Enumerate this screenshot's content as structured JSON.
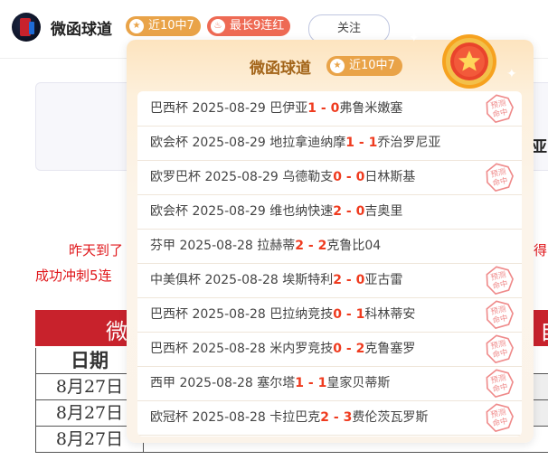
{
  "header": {
    "author": "微函球道",
    "badge_win": "近10中7",
    "badge_streak": "最长9连红",
    "follow_label": "关注"
  },
  "article": {
    "infobox_partial": "亚",
    "line1": "昨天到了",
    "line1_right": "得",
    "line2": "成功冲刺5连",
    "table": {
      "title_left": "微",
      "title_right": "自",
      "col_date": "日期",
      "dates": [
        "8月27日",
        "8月27日",
        "8月27日"
      ]
    }
  },
  "popup": {
    "title": "微函球道",
    "badge": "近10中7",
    "stamp_text": [
      "预测",
      "命中"
    ],
    "matches": [
      {
        "league": "巴西杯",
        "date": "2025-08-29",
        "home": "巴伊亚",
        "hs": "1",
        "sep": " - ",
        "as": "0",
        "away": "弗鲁米嫩塞",
        "hit": true
      },
      {
        "league": "欧会杯",
        "date": "2025-08-29",
        "home": "地拉拿迪纳摩",
        "hs": "1",
        "sep": " - ",
        "as": "1",
        "away": "乔治罗尼亚",
        "hit": false
      },
      {
        "league": "欧罗巴杯",
        "date": "2025-08-29",
        "home": "乌德勒支",
        "hs": "0",
        "sep": " - ",
        "as": "0",
        "away": "日林斯基",
        "hit": true
      },
      {
        "league": "欧会杯",
        "date": "2025-08-29",
        "home": "维也纳快速",
        "hs": "2",
        "sep": " - ",
        "as": "0",
        "away": "吉奥里",
        "hit": false
      },
      {
        "league": "芬甲",
        "date": "2025-08-28",
        "home": "拉赫蒂",
        "hs": "2",
        "sep": " - ",
        "as": "2",
        "away": "克鲁比04",
        "hit": false
      },
      {
        "league": "中美俱杯",
        "date": "2025-08-28",
        "home": "埃斯特利",
        "hs": "2",
        "sep": " - ",
        "as": "0",
        "away": "亚古雷",
        "hit": true
      },
      {
        "league": "巴西杯",
        "date": "2025-08-28",
        "home": "巴拉纳竞技",
        "hs": "0",
        "sep": " - ",
        "as": "1",
        "away": "科林蒂安",
        "hit": true
      },
      {
        "league": "巴西杯",
        "date": "2025-08-28",
        "home": "米内罗竞技",
        "hs": "0",
        "sep": " - ",
        "as": "2",
        "away": "克鲁塞罗",
        "hit": true
      },
      {
        "league": "西甲",
        "date": "2025-08-28",
        "home": "塞尔塔",
        "hs": "1",
        "sep": " - ",
        "as": "1",
        "away": "皇家贝蒂斯",
        "hit": true
      },
      {
        "league": "欧冠杯",
        "date": "2025-08-28",
        "home": "卡拉巴克",
        "hs": "2",
        "sep": " - ",
        "as": "3",
        "away": "费伦茨瓦罗斯",
        "hit": true
      }
    ]
  },
  "colors": {
    "accent_orange": "#e9a348",
    "streak_red": "#ee6a54",
    "score_red": "#ef3b1f",
    "table_red": "#c8222c"
  }
}
